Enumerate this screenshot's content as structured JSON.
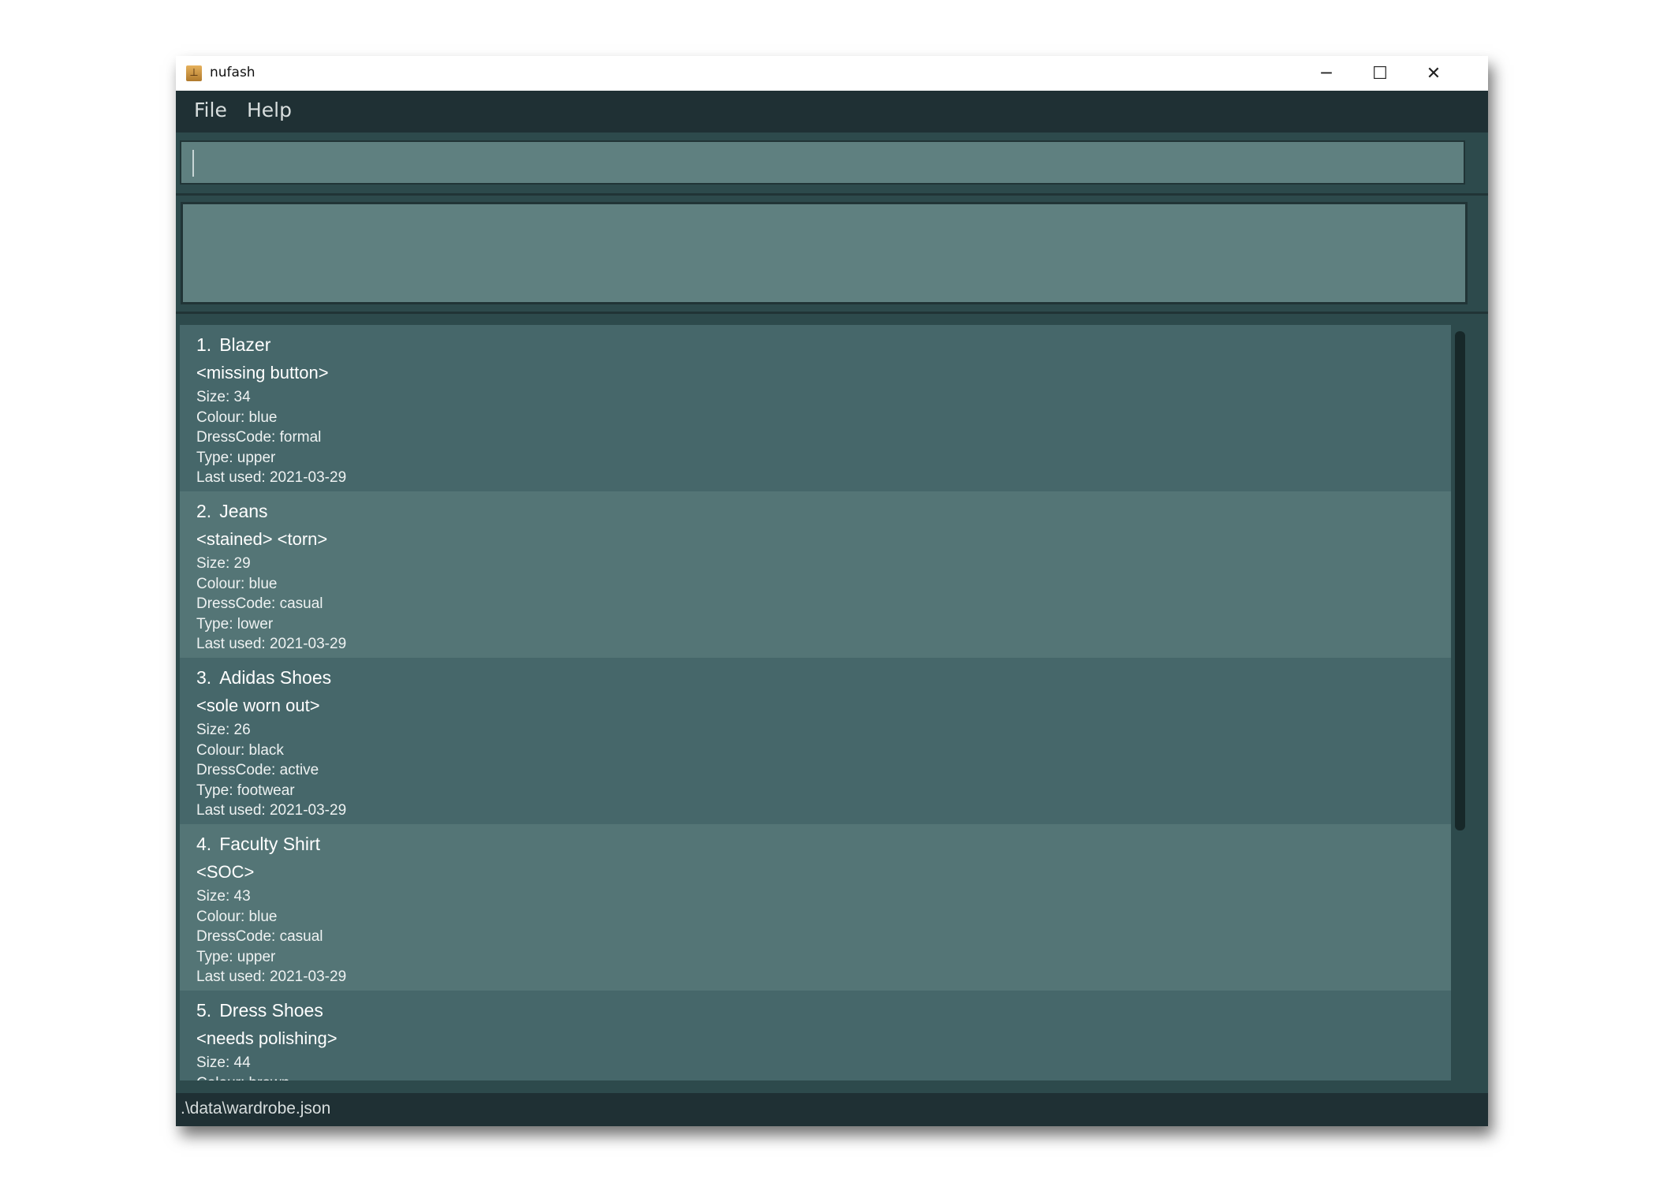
{
  "window": {
    "title": "nufash",
    "icon": "app-icon",
    "minimize": "─",
    "maximize": "☐",
    "close": "✕"
  },
  "menu": {
    "items": [
      "File",
      "Help"
    ]
  },
  "command": {
    "value": "",
    "placeholder": ""
  },
  "result": {
    "text": ""
  },
  "colors": {
    "menubar": "#1f3034",
    "panel": "#2d4a4c",
    "box": "#5f8080",
    "card_odd": "#46676a",
    "card_even": "#547576"
  },
  "list": {
    "items": [
      {
        "index": "1.",
        "name": "Blazer",
        "tags": [
          "<missing button>"
        ],
        "details": [
          "Size: 34",
          "Colour: blue",
          "DressCode: formal",
          "Type: upper",
          "Last used: 2021-03-29"
        ]
      },
      {
        "index": "2.",
        "name": "Jeans",
        "tags": [
          "<stained>",
          "<torn>"
        ],
        "details": [
          "Size: 29",
          "Colour: blue",
          "DressCode: casual",
          "Type: lower",
          "Last used: 2021-03-29"
        ]
      },
      {
        "index": "3.",
        "name": "Adidas Shoes",
        "tags": [
          "<sole worn out>"
        ],
        "details": [
          "Size: 26",
          "Colour: black",
          "DressCode: active",
          "Type: footwear",
          "Last used: 2021-03-29"
        ]
      },
      {
        "index": "4.",
        "name": "Faculty Shirt",
        "tags": [
          "<SOC>"
        ],
        "details": [
          "Size: 43",
          "Colour: blue",
          "DressCode: casual",
          "Type: upper",
          "Last used: 2021-03-29"
        ]
      },
      {
        "index": "5.",
        "name": "Dress Shoes",
        "tags": [
          "<needs polishing>"
        ],
        "details": [
          "Size: 44",
          "Colour: brown"
        ]
      }
    ]
  },
  "status": {
    "file_path": ".\\data\\wardrobe.json"
  }
}
